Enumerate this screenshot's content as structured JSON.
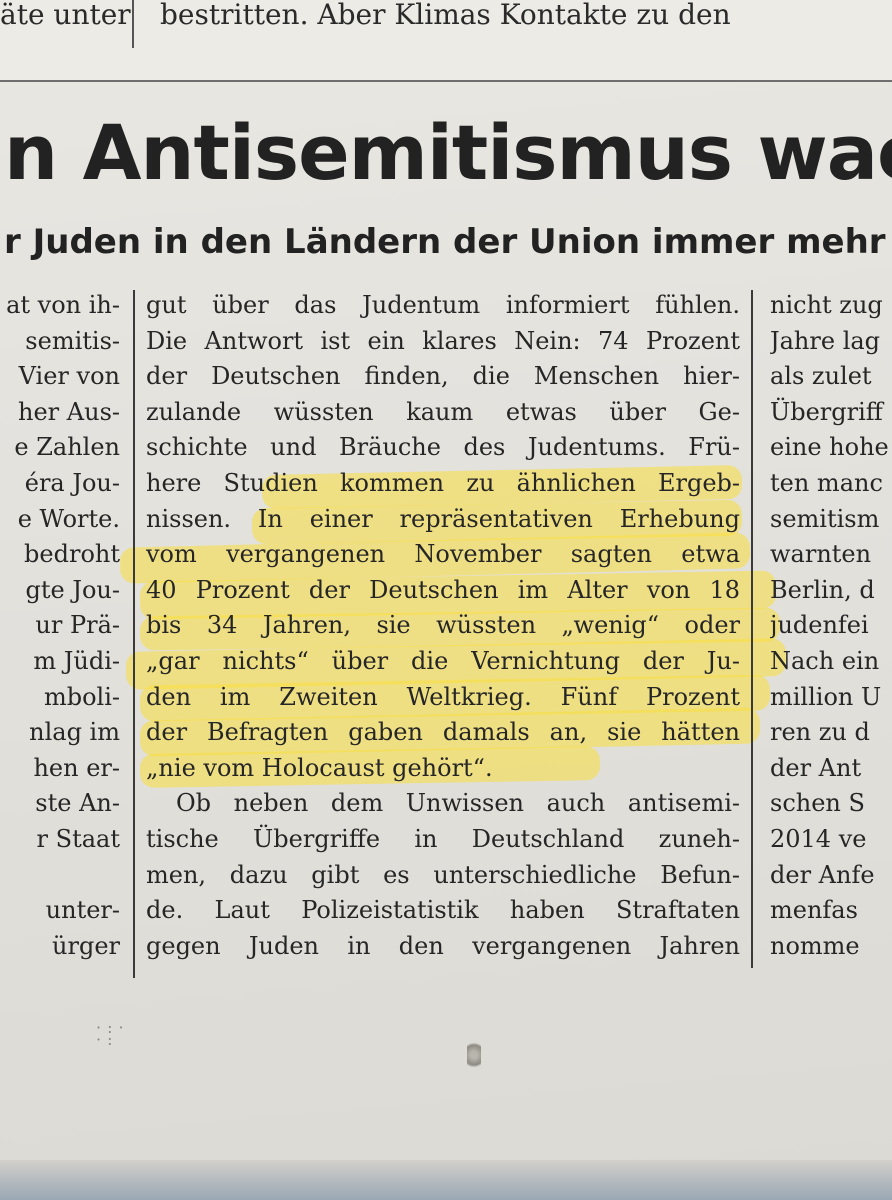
{
  "top_strip": {
    "left_text": "äte unter",
    "right_text": "bestritten. Aber Klimas Kontakte zu den"
  },
  "headline": "n Antisemitismus wachs",
  "subheadline": "r Juden in den Ländern der Union immer mehr Feind",
  "left_column": [
    "at von ih-",
    "semitis-",
    "Vier von",
    "her Aus-",
    "e Zahlen",
    "éra Jou-",
    "e Worte.",
    "bedroht",
    "gte Jou-",
    "ur Prä-",
    "m Jüdi-",
    "mboli-",
    "nlag im",
    "hen er-",
    "ste An-",
    "r Staat",
    "",
    "unter-",
    "ürger"
  ],
  "main_column": [
    "gut über das Judentum informiert fühlen.",
    "Die Antwort ist ein klares Nein: 74 Prozent",
    "der Deutschen finden, die Menschen hier-",
    "zulande wüssten kaum etwas über Ge-",
    "schichte und Bräuche des Judentums. Frü-",
    "here Studien kommen zu ähnlichen Ergeb-",
    "nissen. In einer repräsentativen Erhebung",
    "vom vergangenen November sagten etwa",
    "40 Prozent der Deutschen im Alter von 18",
    "bis 34 Jahren, sie wüssten „wenig“ oder",
    "„gar nichts“ über die Vernichtung der Ju-",
    "den im Zweiten Weltkrieg. Fünf Prozent",
    "der Befragten gaben damals an, sie hätten",
    "„nie vom Holocaust gehört“.",
    "Ob neben dem Unwissen auch antisemi-",
    "tische Übergriffe in Deutschland zuneh-",
    "men, dazu gibt es unterschiedliche Befun-",
    "de. Laut Polizeistatistik haben Straftaten",
    "gegen Juden in den vergangenen Jahren"
  ],
  "right_column": [
    "nicht zug",
    "Jahre lag",
    "als zulet",
    "Übergriff",
    "eine hohe",
    "ten manc",
    "semitism",
    "warnten",
    "Berlin, d",
    "judenfei",
    "Nach ein",
    "million U",
    "ren zu d",
    "der Ant",
    "schen S",
    "2014 ve",
    "der Anfe",
    "menfas",
    "nomme"
  ],
  "highlight_color": "#fade3c"
}
